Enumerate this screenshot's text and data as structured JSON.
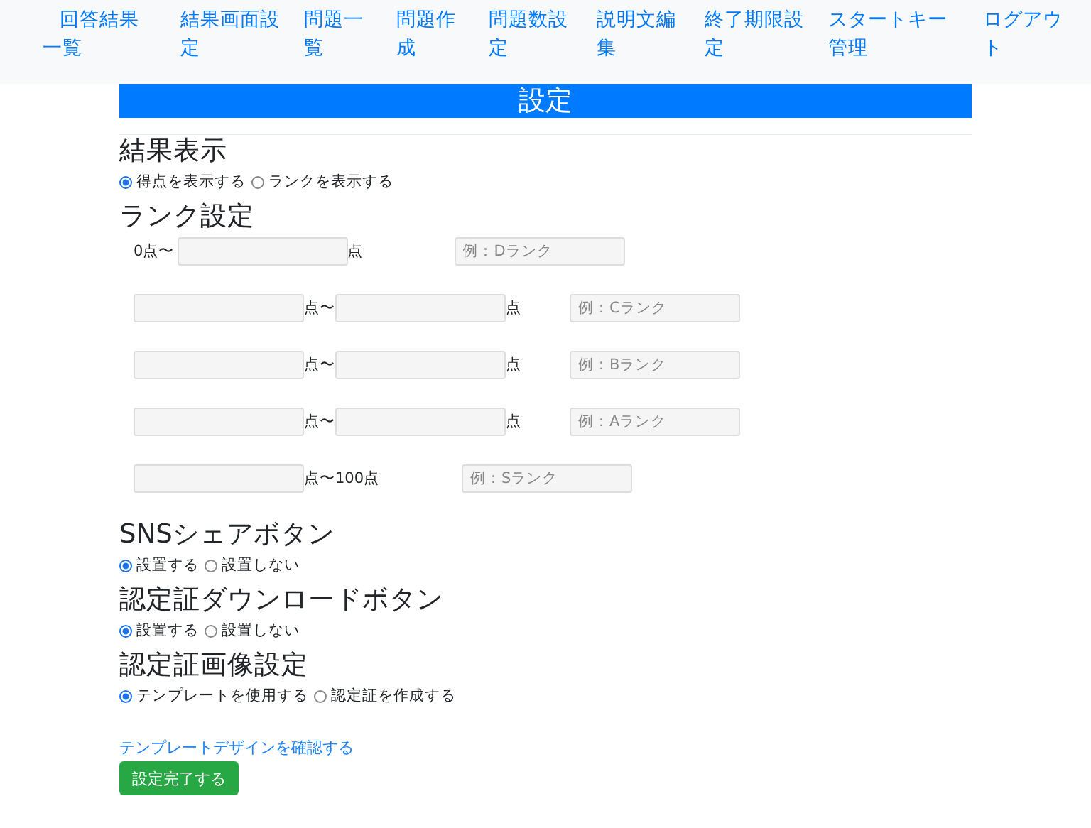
{
  "nav": [
    {
      "label": "回答結果一覧"
    },
    {
      "label": "結果画面設定"
    },
    {
      "label": "問題一覧"
    },
    {
      "label": "問題作成"
    },
    {
      "label": "問題数設定"
    },
    {
      "label": "説明文編集"
    },
    {
      "label": "終了期限設定"
    },
    {
      "label": "スタートキー管理"
    },
    {
      "label": "ログアウト"
    }
  ],
  "title": "設定",
  "sections": [
    {
      "kind": "radios",
      "heading": "結果表示",
      "options": [
        {
          "label": "得点を表示する",
          "selected": true
        },
        {
          "label": "ランクを表示する",
          "selected": false
        }
      ]
    },
    {
      "kind": "ranks",
      "heading": "ランク設定",
      "rows": [
        {
          "parts": [
            {
              "kind": "text",
              "text": "0点〜"
            },
            {
              "kind": "field"
            },
            {
              "kind": "text",
              "text": "点"
            },
            {
              "kind": "example",
              "placeholder": "例：Dランク"
            }
          ]
        },
        {
          "parts": [
            {
              "kind": "field"
            },
            {
              "kind": "text",
              "text": "点〜"
            },
            {
              "kind": "field"
            },
            {
              "kind": "text",
              "text": "点"
            },
            {
              "kind": "example",
              "placeholder": "例：Cランク"
            }
          ]
        },
        {
          "parts": [
            {
              "kind": "field"
            },
            {
              "kind": "text",
              "text": "点〜"
            },
            {
              "kind": "field"
            },
            {
              "kind": "text",
              "text": "点"
            },
            {
              "kind": "example",
              "placeholder": "例：Bランク"
            }
          ]
        },
        {
          "parts": [
            {
              "kind": "field"
            },
            {
              "kind": "text",
              "text": "点〜"
            },
            {
              "kind": "field"
            },
            {
              "kind": "text",
              "text": "点"
            },
            {
              "kind": "example",
              "placeholder": "例：Aランク"
            }
          ]
        },
        {
          "parts": [
            {
              "kind": "field"
            },
            {
              "kind": "text",
              "text": "点〜100点"
            },
            {
              "kind": "example",
              "placeholder": "例：Sランク"
            }
          ]
        }
      ]
    },
    {
      "kind": "radios",
      "heading": "SNSシェアボタン",
      "options": [
        {
          "label": "設置する",
          "selected": true
        },
        {
          "label": "設置しない",
          "selected": false
        }
      ]
    },
    {
      "kind": "radios",
      "heading": "認定証ダウンロードボタン",
      "options": [
        {
          "label": "設置する",
          "selected": true
        },
        {
          "label": "設置しない",
          "selected": false
        }
      ]
    },
    {
      "kind": "radios",
      "heading": "認定証画像設定",
      "options": [
        {
          "label": "テンプレートを使用する",
          "selected": true
        },
        {
          "label": "認定証を作成する",
          "selected": false
        }
      ]
    }
  ],
  "link": "テンプレートデザインを確認する",
  "button": "設定完了する"
}
